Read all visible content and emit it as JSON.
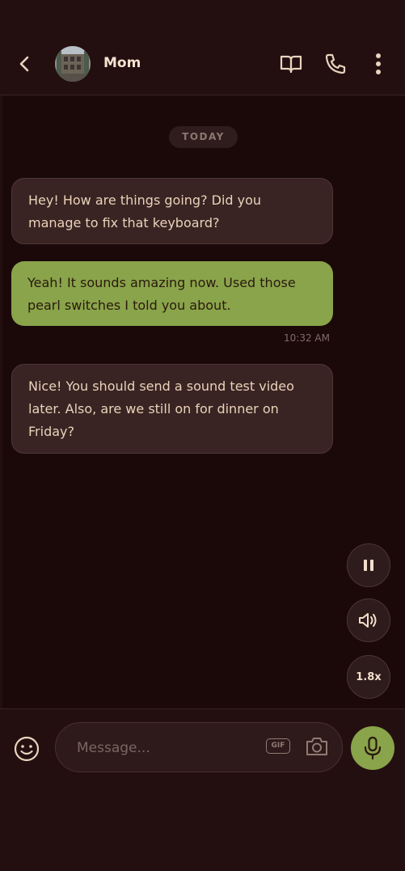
{
  "header": {
    "contact_name": "Mom",
    "icons": [
      "back-icon",
      "book-icon",
      "phone-icon",
      "more-vertical-icon"
    ]
  },
  "chat": {
    "date_divider": "TODAY",
    "messages": [
      {
        "direction": "incoming",
        "text": "Hey! How are things going? Did you manage to fix that keyboard?"
      },
      {
        "direction": "outgoing",
        "text": "Yeah! It sounds amazing now. Used those pearl switches I told you about.",
        "time": "10:32 AM"
      },
      {
        "direction": "incoming",
        "text": "Nice! You should send a sound test video later. Also, are we still on for dinner on Friday?"
      }
    ]
  },
  "playback": {
    "speed_label": "1.8x",
    "icons": [
      "pause-icon",
      "volume-icon"
    ]
  },
  "composer": {
    "placeholder": "Message...",
    "gif_label": "GIF",
    "icons": [
      "emoji-icon",
      "camera-icon",
      "microphone-icon"
    ]
  },
  "colors": {
    "background": "#230f10",
    "chat_background": "#1b090a",
    "incoming_bubble": "#3a2423",
    "outgoing_bubble": "#89a44a",
    "accent": "#89a44a",
    "text": "#e8cdb5"
  }
}
